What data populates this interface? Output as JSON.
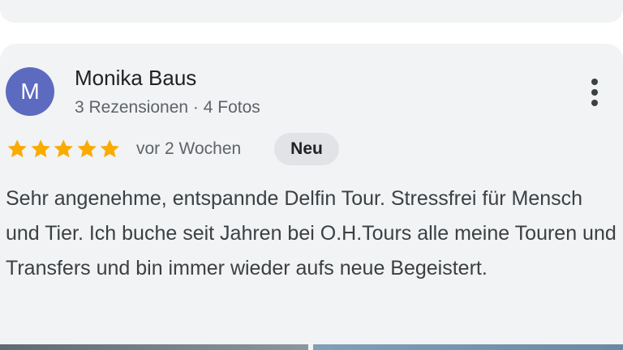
{
  "review": {
    "author_initial": "M",
    "author_name": "Monika Baus",
    "author_meta": "3 Rezensionen · 4 Fotos",
    "rating": 5,
    "rating_max": 5,
    "date": "vor 2 Wochen",
    "badge": "Neu",
    "text": "Sehr angenehme, entspannde Delfin Tour. Stressfrei für Mensch und Tier. Ich buche seit Jahren bei O.H.Tours alle meine Touren und Transfers und bin immer wieder aufs neue Begeistert.",
    "photo_count_visible": 2
  },
  "colors": {
    "card_background": "#f1f3f4",
    "avatar": "#5c6bc0",
    "star": "#f9ab00",
    "badge_background": "#e1e3e6",
    "primary_text": "#202124",
    "secondary_text": "#5f6368"
  },
  "icons": {
    "star": "star-icon",
    "more": "more-vert-icon"
  }
}
